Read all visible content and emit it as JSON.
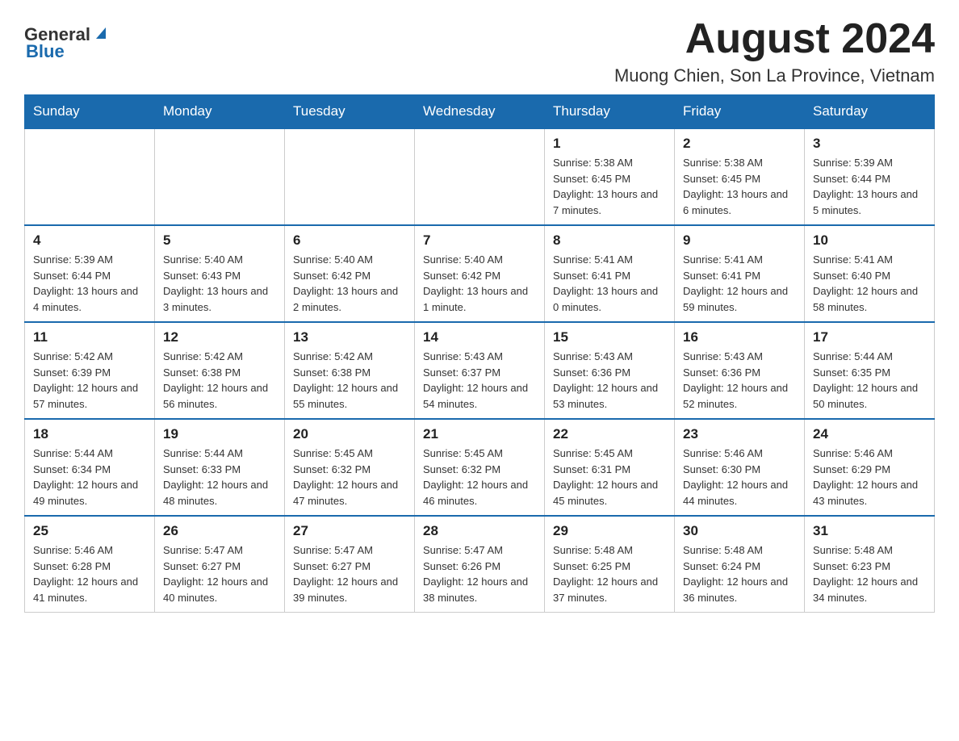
{
  "header": {
    "logo_general": "General",
    "logo_blue": "Blue",
    "month_title": "August 2024",
    "location": "Muong Chien, Son La Province, Vietnam"
  },
  "days_of_week": [
    "Sunday",
    "Monday",
    "Tuesday",
    "Wednesday",
    "Thursday",
    "Friday",
    "Saturday"
  ],
  "weeks": [
    {
      "days": [
        {
          "number": "",
          "info": ""
        },
        {
          "number": "",
          "info": ""
        },
        {
          "number": "",
          "info": ""
        },
        {
          "number": "",
          "info": ""
        },
        {
          "number": "1",
          "info": "Sunrise: 5:38 AM\nSunset: 6:45 PM\nDaylight: 13 hours and 7 minutes."
        },
        {
          "number": "2",
          "info": "Sunrise: 5:38 AM\nSunset: 6:45 PM\nDaylight: 13 hours and 6 minutes."
        },
        {
          "number": "3",
          "info": "Sunrise: 5:39 AM\nSunset: 6:44 PM\nDaylight: 13 hours and 5 minutes."
        }
      ]
    },
    {
      "days": [
        {
          "number": "4",
          "info": "Sunrise: 5:39 AM\nSunset: 6:44 PM\nDaylight: 13 hours and 4 minutes."
        },
        {
          "number": "5",
          "info": "Sunrise: 5:40 AM\nSunset: 6:43 PM\nDaylight: 13 hours and 3 minutes."
        },
        {
          "number": "6",
          "info": "Sunrise: 5:40 AM\nSunset: 6:42 PM\nDaylight: 13 hours and 2 minutes."
        },
        {
          "number": "7",
          "info": "Sunrise: 5:40 AM\nSunset: 6:42 PM\nDaylight: 13 hours and 1 minute."
        },
        {
          "number": "8",
          "info": "Sunrise: 5:41 AM\nSunset: 6:41 PM\nDaylight: 13 hours and 0 minutes."
        },
        {
          "number": "9",
          "info": "Sunrise: 5:41 AM\nSunset: 6:41 PM\nDaylight: 12 hours and 59 minutes."
        },
        {
          "number": "10",
          "info": "Sunrise: 5:41 AM\nSunset: 6:40 PM\nDaylight: 12 hours and 58 minutes."
        }
      ]
    },
    {
      "days": [
        {
          "number": "11",
          "info": "Sunrise: 5:42 AM\nSunset: 6:39 PM\nDaylight: 12 hours and 57 minutes."
        },
        {
          "number": "12",
          "info": "Sunrise: 5:42 AM\nSunset: 6:38 PM\nDaylight: 12 hours and 56 minutes."
        },
        {
          "number": "13",
          "info": "Sunrise: 5:42 AM\nSunset: 6:38 PM\nDaylight: 12 hours and 55 minutes."
        },
        {
          "number": "14",
          "info": "Sunrise: 5:43 AM\nSunset: 6:37 PM\nDaylight: 12 hours and 54 minutes."
        },
        {
          "number": "15",
          "info": "Sunrise: 5:43 AM\nSunset: 6:36 PM\nDaylight: 12 hours and 53 minutes."
        },
        {
          "number": "16",
          "info": "Sunrise: 5:43 AM\nSunset: 6:36 PM\nDaylight: 12 hours and 52 minutes."
        },
        {
          "number": "17",
          "info": "Sunrise: 5:44 AM\nSunset: 6:35 PM\nDaylight: 12 hours and 50 minutes."
        }
      ]
    },
    {
      "days": [
        {
          "number": "18",
          "info": "Sunrise: 5:44 AM\nSunset: 6:34 PM\nDaylight: 12 hours and 49 minutes."
        },
        {
          "number": "19",
          "info": "Sunrise: 5:44 AM\nSunset: 6:33 PM\nDaylight: 12 hours and 48 minutes."
        },
        {
          "number": "20",
          "info": "Sunrise: 5:45 AM\nSunset: 6:32 PM\nDaylight: 12 hours and 47 minutes."
        },
        {
          "number": "21",
          "info": "Sunrise: 5:45 AM\nSunset: 6:32 PM\nDaylight: 12 hours and 46 minutes."
        },
        {
          "number": "22",
          "info": "Sunrise: 5:45 AM\nSunset: 6:31 PM\nDaylight: 12 hours and 45 minutes."
        },
        {
          "number": "23",
          "info": "Sunrise: 5:46 AM\nSunset: 6:30 PM\nDaylight: 12 hours and 44 minutes."
        },
        {
          "number": "24",
          "info": "Sunrise: 5:46 AM\nSunset: 6:29 PM\nDaylight: 12 hours and 43 minutes."
        }
      ]
    },
    {
      "days": [
        {
          "number": "25",
          "info": "Sunrise: 5:46 AM\nSunset: 6:28 PM\nDaylight: 12 hours and 41 minutes."
        },
        {
          "number": "26",
          "info": "Sunrise: 5:47 AM\nSunset: 6:27 PM\nDaylight: 12 hours and 40 minutes."
        },
        {
          "number": "27",
          "info": "Sunrise: 5:47 AM\nSunset: 6:27 PM\nDaylight: 12 hours and 39 minutes."
        },
        {
          "number": "28",
          "info": "Sunrise: 5:47 AM\nSunset: 6:26 PM\nDaylight: 12 hours and 38 minutes."
        },
        {
          "number": "29",
          "info": "Sunrise: 5:48 AM\nSunset: 6:25 PM\nDaylight: 12 hours and 37 minutes."
        },
        {
          "number": "30",
          "info": "Sunrise: 5:48 AM\nSunset: 6:24 PM\nDaylight: 12 hours and 36 minutes."
        },
        {
          "number": "31",
          "info": "Sunrise: 5:48 AM\nSunset: 6:23 PM\nDaylight: 12 hours and 34 minutes."
        }
      ]
    }
  ]
}
